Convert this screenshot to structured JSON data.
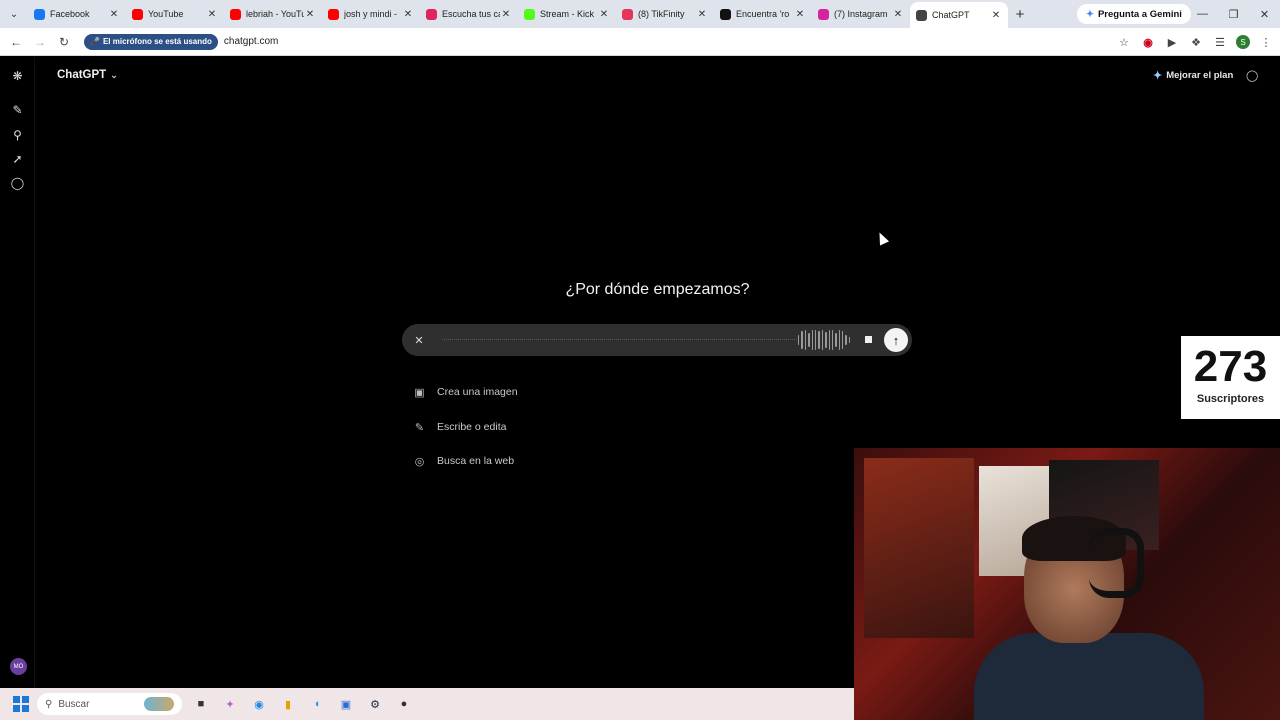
{
  "browser": {
    "tabs": [
      {
        "title": "Facebook",
        "icon": "facebook-icon",
        "color": "#1877f2",
        "active": false
      },
      {
        "title": "YouTube",
        "icon": "youtube-icon",
        "color": "#ff0000",
        "active": false
      },
      {
        "title": "lebriah - YouTu",
        "icon": "youtube-icon",
        "color": "#ff0000",
        "active": false
      },
      {
        "title": "josh y mindi -",
        "icon": "youtube-icon",
        "color": "#ff0000",
        "active": false
      },
      {
        "title": "Escucha tus ca",
        "icon": "podcast-icon",
        "color": "#e0245e",
        "active": false
      },
      {
        "title": "Stream - Kick",
        "icon": "kick-icon",
        "color": "#53fc18",
        "active": false
      },
      {
        "title": "(8) TikFinity",
        "icon": "tikfinity-icon",
        "color": "#e6345b",
        "active": false
      },
      {
        "title": "Encuentra 'ro",
        "icon": "tiktok-icon",
        "color": "#111111",
        "active": false
      },
      {
        "title": "(7) Instagram",
        "icon": "instagram-icon",
        "color": "#d6249f",
        "active": false
      },
      {
        "title": "ChatGPT",
        "icon": "chatgpt-icon",
        "color": "#444444",
        "active": true
      }
    ],
    "gemini_label": "Pregunta a Gemini",
    "mic_chip": "El micrófono se está usando",
    "url": "chatgpt.com"
  },
  "app": {
    "model_name": "ChatGPT",
    "upgrade_label": "Mejorar el plan",
    "heading": "¿Por dónde empezamos?",
    "suggestions": [
      {
        "label": "Crea una imagen",
        "icon": "image-icon"
      },
      {
        "label": "Escribe o edita",
        "icon": "pencil-icon"
      },
      {
        "label": "Busca en la web",
        "icon": "globe-icon"
      }
    ],
    "avatar_initials": "MO"
  },
  "overlay": {
    "subscriber_count": "273",
    "subscriber_label": "Suscriptores"
  },
  "taskbar": {
    "search_placeholder": "Buscar"
  }
}
